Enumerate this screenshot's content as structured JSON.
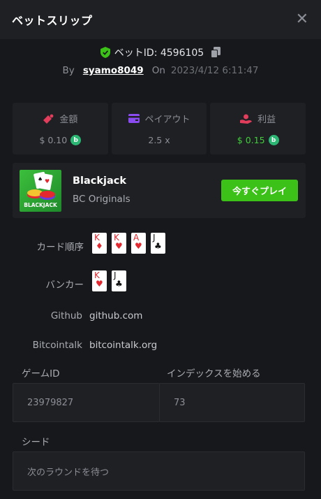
{
  "header": {
    "title": "ベットスリップ",
    "close_icon": "✕"
  },
  "bet": {
    "id_label": "ベットID: 4596105",
    "by_label": "By",
    "username": "syamo8049",
    "on_label": "On",
    "datetime": "2023/4/12 6:11:47"
  },
  "stats": [
    {
      "label": "金額",
      "value": "$ 0.10",
      "icon": "bet-amount-icon",
      "color": "#e23d5b"
    },
    {
      "label": "ペイアウト",
      "value": "2.5 x",
      "icon": "card-icon",
      "color": "#8a4bf0"
    },
    {
      "label": "利益",
      "value": "$ 0.15",
      "icon": "profit-icon",
      "color": "#e23d5b"
    }
  ],
  "game": {
    "name": "Blackjack",
    "provider": "BC Originals",
    "thumb_text": "BLACKJACK",
    "play_label": "今すぐプレイ"
  },
  "details": {
    "card_order_label": "カード順序",
    "card_order": [
      {
        "rank": "K",
        "suit": "♦",
        "color": "red"
      },
      {
        "rank": "K",
        "suit": "♥",
        "color": "red"
      },
      {
        "rank": "A",
        "suit": "♥",
        "color": "red"
      },
      {
        "rank": "J",
        "suit": "♣",
        "color": "black"
      }
    ],
    "banker_label": "バンカー",
    "banker_cards": [
      {
        "rank": "K",
        "suit": "♥",
        "color": "red"
      },
      {
        "rank": "J",
        "suit": "♣",
        "color": "black"
      }
    ],
    "github_label": "Github",
    "github_value": "github.com",
    "bitcointalk_label": "Bitcointalk",
    "bitcointalk_value": "bitcointalk.org"
  },
  "fields": {
    "game_id_label": "ゲームID",
    "game_id_value": "23979827",
    "start_index_label": "インデックスを始める",
    "start_index_value": "73",
    "seed_label": "シード",
    "seed_value": "次のラウンドを待つ"
  },
  "colors": {
    "accent_green": "#3bc117",
    "profit_green": "#3fcf3a",
    "coin": "#2bb673"
  }
}
